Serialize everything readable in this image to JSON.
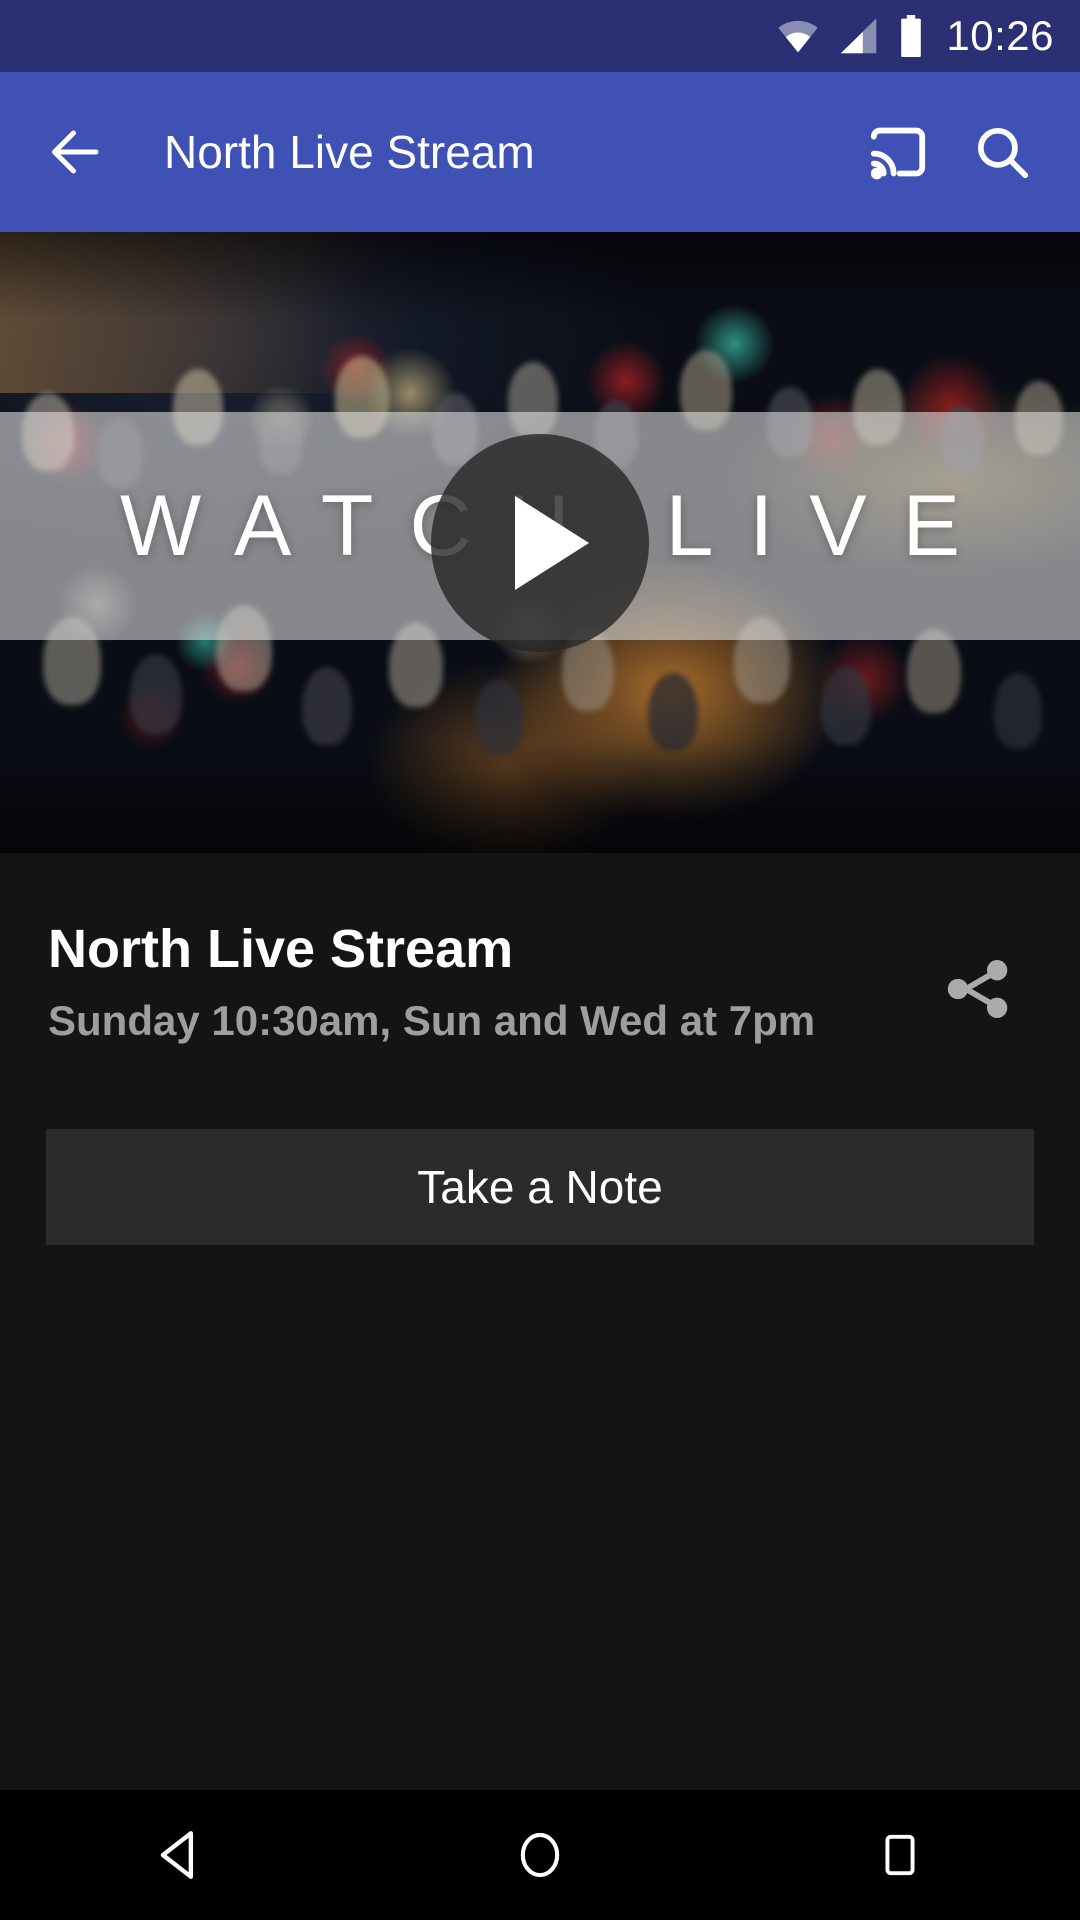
{
  "status_bar": {
    "time": "10:26",
    "icons": [
      "wifi-icon",
      "cellular-signal-icon",
      "battery-icon"
    ],
    "background_color": "#2a3073"
  },
  "app_bar": {
    "title": "North Live Stream",
    "back_icon": "arrow-left-icon",
    "cast_icon": "chromecast-icon",
    "search_icon": "search-icon",
    "background_color": "#3f51b5",
    "text_color": "#ffffff"
  },
  "video": {
    "overlay_text": "WATCH LIVE",
    "play_icon": "play-triangle-icon",
    "description": "Church congregation with raised hands in auditorium"
  },
  "details": {
    "title": "North Live Stream",
    "subtitle": "Sunday 10:30am, Sun and Wed at 7pm",
    "share_icon": "share-icon",
    "share_color": "#ababab",
    "subtitle_color": "#9e9e9e"
  },
  "actions": {
    "take_note_label": "Take a Note",
    "take_note_background": "#2b2b2b"
  },
  "nav_bar": {
    "back_icon": "triangle-back-icon",
    "home_icon": "circle-home-icon",
    "recents_icon": "square-recents-icon",
    "background_color": "#000000"
  }
}
